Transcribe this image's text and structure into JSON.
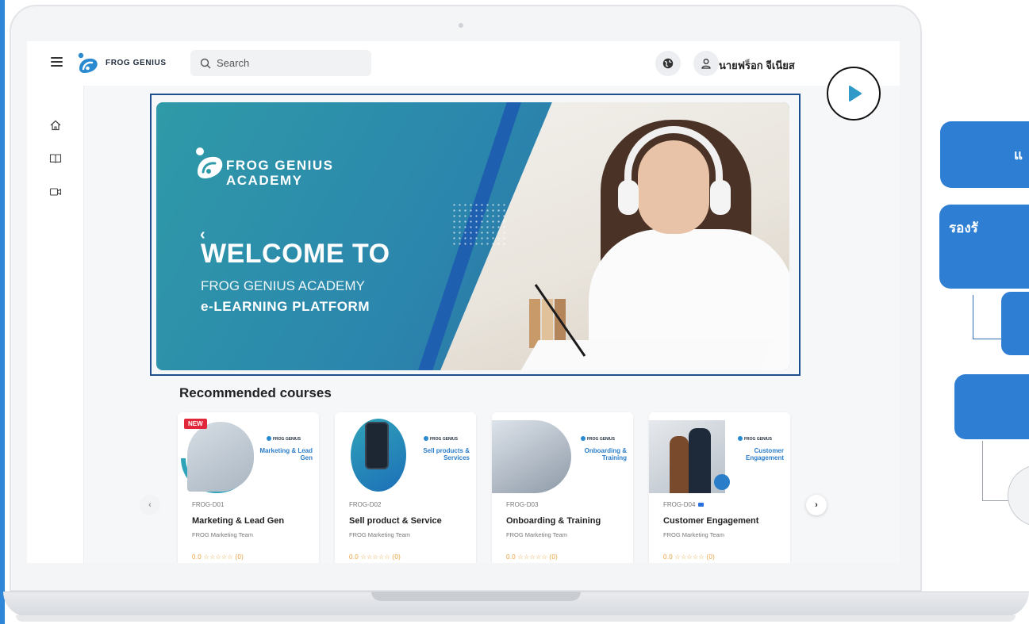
{
  "app": {
    "brand": "FROG GENIUS",
    "search_placeholder": "Search",
    "user_name": "นายฟร็อก จีเนียส"
  },
  "sidebar": {
    "items": [
      {
        "name": "home-icon"
      },
      {
        "name": "book-icon"
      },
      {
        "name": "video-icon"
      }
    ]
  },
  "banner": {
    "logo_line1": "FROG GENIUS",
    "logo_line2": "ACADEMY",
    "heading": "WELCOME TO",
    "sub1": "FROG GENIUS ACADEMY",
    "sub2": "e-LEARNING PLATFORM"
  },
  "recommended": {
    "title": "Recommended courses",
    "courses": [
      {
        "code": "FROG-D01",
        "title": "Marketing & Lead Gen",
        "team": "FROG Marketing Team",
        "thumb_title": "Marketing & Lead Gen",
        "badge": "NEW",
        "rating": "0.0 ☆☆☆☆☆ (0)"
      },
      {
        "code": "FROG-D02",
        "title": "Sell product & Service",
        "team": "FROG Marketing Team",
        "thumb_title": "Sell products & Services",
        "rating": "0.0 ☆☆☆☆☆ (0)"
      },
      {
        "code": "FROG-D03",
        "title": "Onboarding & Training",
        "team": "FROG Marketing Team",
        "thumb_title": "Onboarding & Training",
        "rating": "0.0 ☆☆☆☆☆ (0)"
      },
      {
        "code": "FROG-D04",
        "title": "Customer Engagement",
        "team": "FROG Marketing Team",
        "thumb_title": "Customer Engagement",
        "rating": "0.0 ☆☆☆☆☆ (0)"
      }
    ],
    "thumb_brand": "FROG GENIUS"
  },
  "slide_right": {
    "block1": "แ",
    "block2": "รองรั"
  },
  "colors": {
    "accent": "#2e7fd4",
    "banner_frame": "#1f4e8c",
    "badge_new": "#e0283a"
  }
}
